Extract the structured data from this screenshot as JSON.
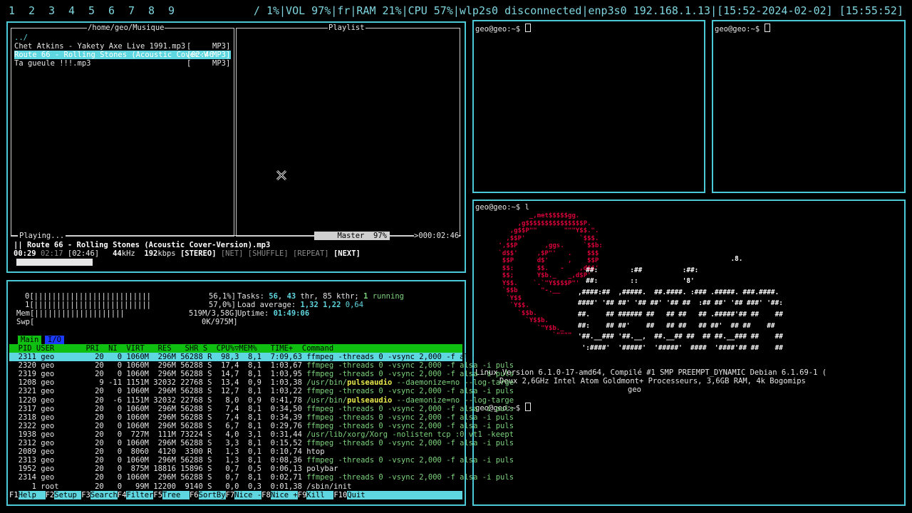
{
  "statusbar": {
    "workspaces": [
      "1",
      "2",
      "3",
      "4",
      "5",
      "6",
      "7",
      "8",
      "9"
    ],
    "status": "/ 1%|VOL 97%|fr|RAM 21%|CPU 57%|wlp2s0 disconnected|enp3s0 192.168.1.13|[15:52-2024-02-02] [15:55:52]"
  },
  "player": {
    "browser_title": "/home/geo/Musique",
    "playlist_title": "Playlist",
    "parent": "../",
    "files": [
      {
        "name": "Chet Atkins - Yakety Axe Live 1991.mp3",
        "time": "[      ",
        "type": "MP3]"
      },
      {
        "name": "Route 66 - Rolling Stones (Acoustic Cover-V",
        "time": "02:46",
        "type": "MP3]"
      },
      {
        "name": "Ta gueule !!!.mp3",
        "time": "[      ",
        "type": "MP3]"
      }
    ],
    "playing_label": "Playing...",
    "mixer": "Master  97%",
    "total": ">000:02:46",
    "now_playing": "|| Route 66 - Rolling Stones (Acoustic Cover-Version).mp3",
    "elapsed": "00:29",
    "remaining": "02:17",
    "duration": "[02:46]",
    "khz": "44",
    "kbps": "192",
    "stereo": "[STEREO]",
    "net": "[NET]",
    "shuffle": "[SHUFFLE]",
    "repeat": "[REPEAT]",
    "next": "[NEXT]",
    "progress": 0.175
  },
  "terminals": {
    "prompt": "geo@geo:~$ ",
    "cmd_l": "l"
  },
  "neofetch": {
    "line1": "Linux Version 6.1.0-17-amd64, Compilé #1 SMP PREEMPT_DYNAMIC Debian 6.1.69-1 (",
    "line2": "Deux 2,6GHz Intel Atom Goldmont+ Processeurs, 3,6GB RAM, 4k Bogomips",
    "line3": "geo",
    "swirl": [
      "              _,met$$$$$gg.",
      "           ,g$$$$$$$$$$$$$$$P.",
      "         ,g$$P\"\"       \"\"\"Y$$.\".",
      "        ,$$P'              `$$$.",
      "      ',$$P       ,ggs.     `$$b:",
      "      `d$$'     ,$P\"'   .    $$$",
      "       $$P      d$'     ,    $$P",
      "       $$:      $$.   -    ,d$$'",
      "       $$;      Y$b._   _,d$P'",
      "       Y$$.    `.`\"Y$$$$P\"'",
      "       `$$b      \"-.__",
      "        `Y$$",
      "         `Y$$.",
      "           `$$b.",
      "             `Y$$b.",
      "                `\"Y$b._",
      "                    `\"\"\"\""
    ],
    "word": [
      "                                      .8.",
      "  ##:        :##          :##:",
      "  ##:        ::           '8'",
      ",####:##  ,#####.  ##.####. :### .#####. ###.####.",
      "####' '## ##' '## ##' '## ##  :## ##' '## ###' '##:",
      "##.    ## ###### ##   ## ##   ## .#####'## ##    ##",
      "##:    ## ##'    ##   ## ##   ## ##'  ## ##    ##",
      "'##.__### '##.__,  ##.__## ##  ## ##.__### ##    ##",
      " ':####'  '#####'  '#####'  ####  '####'## ##    ##"
    ]
  },
  "htop": {
    "cpu0": "0[||||||||||||||||||||||||||",
    "cpu0_pct": "56,1%]",
    "cpu1": "1[||||||||||||||||||||||||||",
    "cpu1_pct": "57,0%]",
    "mem": "Mem[||||||||||||||||||||",
    "mem_val": "519M/3,58G]",
    "swp": "Swp[",
    "swp_val": "0K/975M]",
    "tasks": "Tasks: ",
    "tasks_n": "56",
    "tasks_sep": ", ",
    "thr_n": "43",
    "thr_txt": " thr, 85 kthr; ",
    "running_n": "1",
    "running_txt": " running",
    "load_txt": "Load average: ",
    "load1": "1,32",
    "load2": "1,22",
    "load3": "0,64",
    "uptime_txt": "Uptime: ",
    "uptime": "01:49:06",
    "tab_main": "Main",
    "tab_io": "I/O",
    "header": "  PID USER       PRI  NI  VIRT   RES   SHR S  CPU%▽MEM%   TIME+  Command",
    "rows": [
      {
        "pid": " 2311",
        "user": "geo",
        "pri": "20",
        "ni": "0",
        "virt": "1060M",
        "res": "296M",
        "shr": "56288",
        "s": "R",
        "cpu": "98,3",
        "mem": "8,1",
        "time": "7:09,63",
        "cmd": "ffmpeg -threads 0 -vsync 2,000 -f alsa -i puls",
        "sel": true
      },
      {
        "pid": " 2320",
        "user": "geo",
        "pri": "20",
        "ni": "0",
        "virt": "1060M",
        "res": "296M",
        "shr": "56288",
        "s": "S",
        "cpu": "17,4",
        "mem": "8,1",
        "time": "1:03,67",
        "cmd": "ffmpeg -threads 0 -vsync 2,000 -f alsa -i puls"
      },
      {
        "pid": " 2319",
        "user": "geo",
        "pri": "20",
        "ni": "0",
        "virt": "1060M",
        "res": "296M",
        "shr": "56288",
        "s": "S",
        "cpu": "14,7",
        "mem": "8,1",
        "time": "1:03,95",
        "cmd": "ffmpeg -threads 0 -vsync 2,000 -f alsa -i puls"
      },
      {
        "pid": " 1208",
        "user": "geo",
        "pri": "9",
        "ni": "-11",
        "virt": "1151M",
        "res": "32032",
        "shr": "22768",
        "s": "S",
        "cpu": "13,4",
        "mem": "0,9",
        "time": "1:03,38",
        "cmd": "/usr/bin/pulseaudio --daemonize=no --log-targe",
        "pulse": true
      },
      {
        "pid": " 2321",
        "user": "geo",
        "pri": "20",
        "ni": "0",
        "virt": "1060M",
        "res": "296M",
        "shr": "56288",
        "s": "S",
        "cpu": "12,7",
        "mem": "8,1",
        "time": "1:03,22",
        "cmd": "ffmpeg -threads 0 -vsync 2,000 -f alsa -i puls"
      },
      {
        "pid": " 1220",
        "user": "geo",
        "pri": "20",
        "ni": "-6",
        "virt": "1151M",
        "res": "32032",
        "shr": "22768",
        "s": "S",
        "cpu": "8,0",
        "mem": "0,9",
        "time": "0:41,78",
        "cmd": "/usr/bin/pulseaudio --daemonize=no --log-targe",
        "pulse": true
      },
      {
        "pid": " 2317",
        "user": "geo",
        "pri": "20",
        "ni": "0",
        "virt": "1060M",
        "res": "296M",
        "shr": "56288",
        "s": "S",
        "cpu": "7,4",
        "mem": "8,1",
        "time": "0:34,50",
        "cmd": "ffmpeg -threads 0 -vsync 2,000 -f alsa -i puls"
      },
      {
        "pid": " 2318",
        "user": "geo",
        "pri": "20",
        "ni": "0",
        "virt": "1060M",
        "res": "296M",
        "shr": "56288",
        "s": "S",
        "cpu": "7,4",
        "mem": "8,1",
        "time": "0:34,39",
        "cmd": "ffmpeg -threads 0 -vsync 2,000 -f alsa -i puls"
      },
      {
        "pid": " 2322",
        "user": "geo",
        "pri": "20",
        "ni": "0",
        "virt": "1060M",
        "res": "296M",
        "shr": "56288",
        "s": "S",
        "cpu": "6,7",
        "mem": "8,1",
        "time": "0:29,76",
        "cmd": "ffmpeg -threads 0 -vsync 2,000 -f alsa -i puls"
      },
      {
        "pid": " 1938",
        "user": "geo",
        "pri": "20",
        "ni": "0",
        "virt": "727M",
        "res": "111M",
        "shr": "73224",
        "s": "S",
        "cpu": "4,0",
        "mem": "3,1",
        "time": "0:31,44",
        "cmd": "/usr/lib/xorg/Xorg -nolisten tcp :0 vt1 -keept"
      },
      {
        "pid": " 2312",
        "user": "geo",
        "pri": "20",
        "ni": "0",
        "virt": "1060M",
        "res": "296M",
        "shr": "56288",
        "s": "S",
        "cpu": "3,3",
        "mem": "8,1",
        "time": "0:15,52",
        "cmd": "ffmpeg -threads 0 -vsync 2,000 -f alsa -i puls"
      },
      {
        "pid": " 2089",
        "user": "geo",
        "pri": "20",
        "ni": "0",
        "virt": "8060",
        "res": "4120",
        "shr": "3300",
        "s": "R",
        "cpu": "1,3",
        "mem": "0,1",
        "time": "0:10,74",
        "cmd": "htop",
        "plain": true
      },
      {
        "pid": " 2313",
        "user": "geo",
        "pri": "20",
        "ni": "0",
        "virt": "1060M",
        "res": "296M",
        "shr": "56288",
        "s": "S",
        "cpu": "1,3",
        "mem": "8,1",
        "time": "0:08,36",
        "cmd": "ffmpeg -threads 0 -vsync 2,000 -f alsa -i puls"
      },
      {
        "pid": " 1952",
        "user": "geo",
        "pri": "20",
        "ni": "0",
        "virt": "875M",
        "res": "18816",
        "shr": "15896",
        "s": "S",
        "cpu": "0,7",
        "mem": "0,5",
        "time": "0:06,13",
        "cmd": "polybar",
        "plain": true
      },
      {
        "pid": " 2314",
        "user": "geo",
        "pri": "20",
        "ni": "0",
        "virt": "1060M",
        "res": "296M",
        "shr": "56288",
        "s": "S",
        "cpu": "0,7",
        "mem": "8,1",
        "time": "0:02,71",
        "cmd": "ffmpeg -threads 0 -vsync 2,000 -f alsa -i puls"
      },
      {
        "pid": "    1",
        "user": "root",
        "pri": "20",
        "ni": "0",
        "virt": "99M",
        "res": "12200",
        "shr": "9140",
        "s": "S",
        "cpu": "0,0",
        "mem": "0,3",
        "time": "0:01,38",
        "cmd": "/sbin/init",
        "plain": true
      }
    ],
    "fkeys": [
      {
        "k": "F1",
        "l": "Help  "
      },
      {
        "k": "F2",
        "l": "Setup "
      },
      {
        "k": "F3",
        "l": "Search"
      },
      {
        "k": "F4",
        "l": "Filter"
      },
      {
        "k": "F5",
        "l": "Tree  "
      },
      {
        "k": "F6",
        "l": "SortBy"
      },
      {
        "k": "F7",
        "l": "Nice -"
      },
      {
        "k": "F8",
        "l": "Nice +"
      },
      {
        "k": "F9",
        "l": "Kill  "
      },
      {
        "k": "F10",
        "l": "Quit"
      }
    ]
  },
  "colors": {
    "accent": "#4cc9d6",
    "debian": "#d7003a",
    "htop_header": "#10c010",
    "selection": "#5fd7e0"
  }
}
